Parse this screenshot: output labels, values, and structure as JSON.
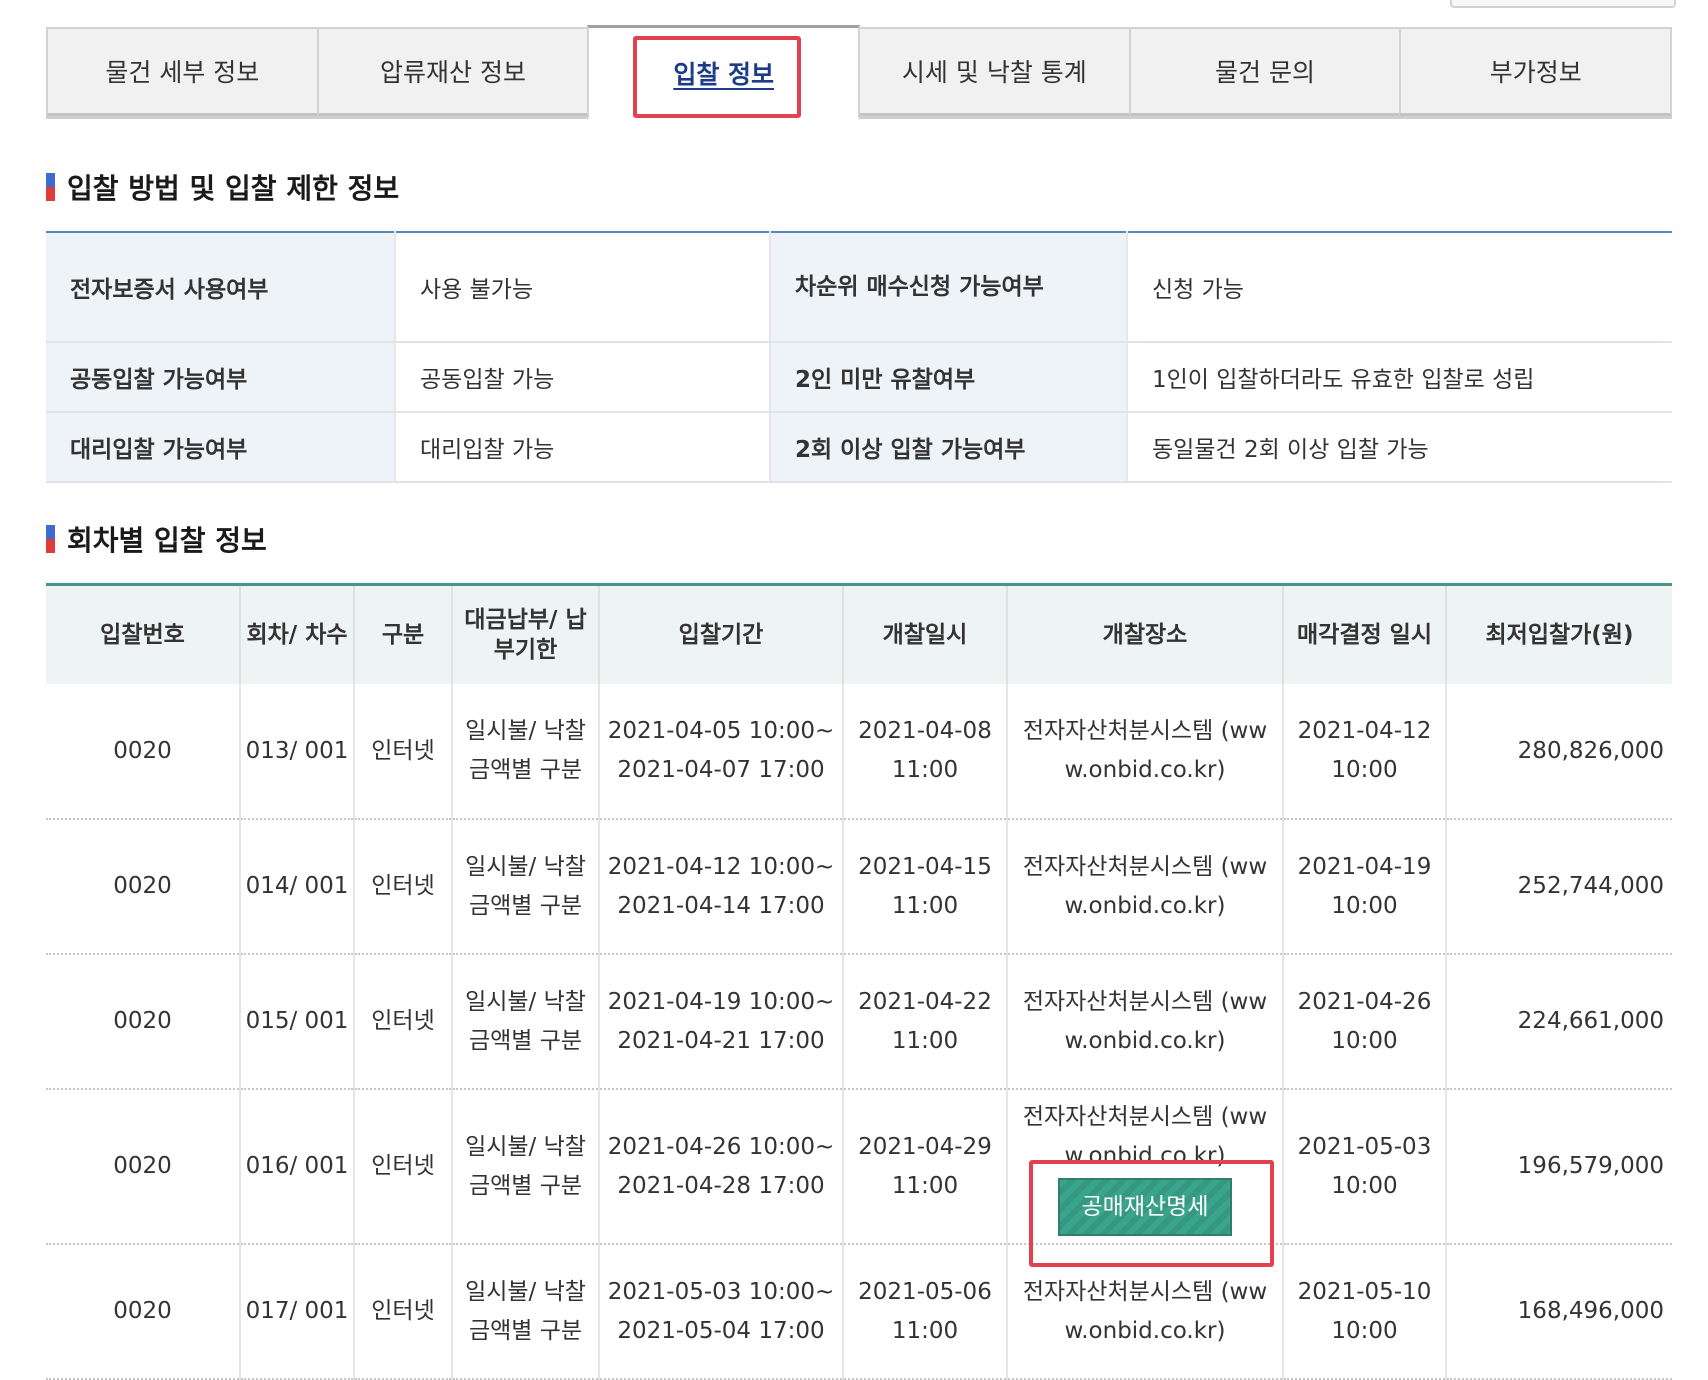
{
  "tabs": [
    {
      "label": "물건 세부 정보",
      "active": false
    },
    {
      "label": "압류재산 정보",
      "active": false
    },
    {
      "label": "입찰 정보",
      "active": true
    },
    {
      "label": "시세 및 낙찰 통계",
      "active": false
    },
    {
      "label": "물건 문의",
      "active": false
    },
    {
      "label": "부가정보",
      "active": false
    }
  ],
  "section1": {
    "title": "입찰 방법 및 입찰 제한 정보",
    "rows": [
      {
        "label1": "전자보증서 사용여부",
        "value1": "사용 불가능",
        "label2": "차순위 매수신청 가능여부",
        "value2": "신청 가능"
      },
      {
        "label1": "공동입찰 가능여부",
        "value1": "공동입찰 가능",
        "label2": "2인 미만 유찰여부",
        "value2": "1인이 입찰하더라도 유효한 입찰로 성립"
      },
      {
        "label1": "대리입찰 가능여부",
        "value1": "대리입찰 가능",
        "label2": "2회 이상 입찰 가능여부",
        "value2": "동일물건 2회 이상 입찰 가능"
      }
    ]
  },
  "section2": {
    "title": "회차별 입찰 정보",
    "headers": [
      "입찰번호",
      "회차/ 차수",
      "구분",
      "대금납부/ 납부기한",
      "입찰기간",
      "개찰일시",
      "개찰장소",
      "매각결정 일시",
      "최저입찰가(원)"
    ],
    "rows": [
      {
        "bid_no": "0020",
        "round": "013/ 001",
        "type": "인터넷",
        "payment": "일시불/ 낙찰금액별 구분",
        "period": "2021-04-05 10:00~ 2021-04-07 17:00",
        "open": "2021-04-08 11:00",
        "place": "전자자산처분시스템 (www.onbid.co.kr)",
        "decision": "2021-04-12 10:00",
        "price": "280,826,000"
      },
      {
        "bid_no": "0020",
        "round": "014/ 001",
        "type": "인터넷",
        "payment": "일시불/ 낙찰금액별 구분",
        "period": "2021-04-12 10:00~ 2021-04-14 17:00",
        "open": "2021-04-15 11:00",
        "place": "전자자산처분시스템 (www.onbid.co.kr)",
        "decision": "2021-04-19 10:00",
        "price": "252,744,000"
      },
      {
        "bid_no": "0020",
        "round": "015/ 001",
        "type": "인터넷",
        "payment": "일시불/ 낙찰금액별 구분",
        "period": "2021-04-19 10:00~ 2021-04-21 17:00",
        "open": "2021-04-22 11:00",
        "place": "전자자산처분시스템 (www.onbid.co.kr)",
        "decision": "2021-04-26 10:00",
        "price": "224,661,000"
      },
      {
        "bid_no": "0020",
        "round": "016/ 001",
        "type": "인터넷",
        "payment": "일시불/ 낙찰금액별 구분",
        "period": "2021-04-26 10:00~ 2021-04-28 17:00",
        "open": "2021-04-29 11:00",
        "place": "전자자산처분시스템 (www.onbid.co.kr)",
        "decision": "2021-05-03 10:00",
        "price": "196,579,000",
        "button": "공매재산명세"
      },
      {
        "bid_no": "0020",
        "round": "017/ 001",
        "type": "인터넷",
        "payment": "일시불/ 낙찰금액별 구분",
        "period": "2021-05-03 10:00~ 2021-05-04 17:00",
        "open": "2021-05-06 11:00",
        "place": "전자자산처분시스템 (www.onbid.co.kr)",
        "decision": "2021-05-10 10:00",
        "price": "168,496,000"
      }
    ]
  }
}
